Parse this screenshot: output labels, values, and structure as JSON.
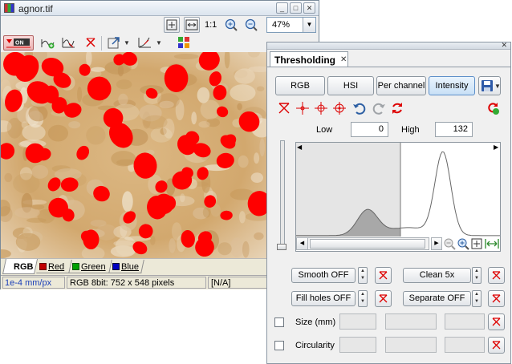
{
  "image_window": {
    "title": "agnor.tif",
    "zoom_reset_label": "1:1",
    "zoom_value": "47%",
    "tabs": [
      {
        "label": "RGB",
        "color": ""
      },
      {
        "label": "Red",
        "color": "#c00000"
      },
      {
        "label": "Green",
        "color": "#00a000"
      },
      {
        "label": "Blue",
        "color": "#0000c0"
      }
    ],
    "status": {
      "scale": "1e-4 mm/px",
      "info": "RGB 8bit: 752 x 548 pixels",
      "value": "[N/A]"
    },
    "colors": {
      "overlay": "#ff0000",
      "background": "#d8b27a"
    }
  },
  "threshold_panel": {
    "tab_label": "Thresholding",
    "modes": [
      "RGB",
      "HSI",
      "Per channel",
      "Intensity"
    ],
    "active_mode": "Intensity",
    "low_label": "Low",
    "low_value": "0",
    "high_label": "High",
    "high_value": "132",
    "options": {
      "smooth": "Smooth OFF",
      "clean": "Clean 5x",
      "fill_holes": "Fill holes OFF",
      "separate": "Separate OFF"
    },
    "size_label": "Size (mm)",
    "circularity_label": "Circularity"
  }
}
